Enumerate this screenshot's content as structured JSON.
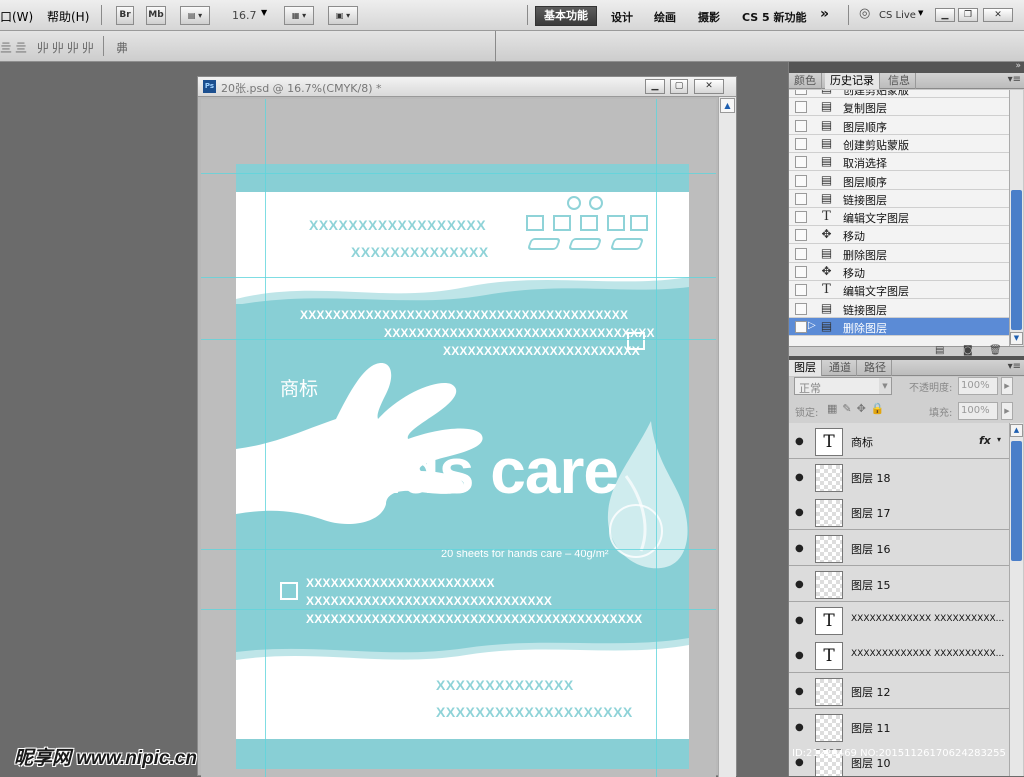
{
  "menu": {
    "window": "口(W)",
    "help": "帮助(H)"
  },
  "toolbar": {
    "bridge": "Br",
    "minibridge": "Mb",
    "zoom": "16.7"
  },
  "workspaces": [
    "基本功能",
    "设计",
    "绘画",
    "摄影",
    "CS 5 新功能"
  ],
  "cs_live": "CS Live",
  "document": {
    "title": "20张.psd @ 16.7%(CMYK/8) *",
    "header_xx_1": "XXXXXXXXXXXXXXXXXX",
    "header_xx_2": "XXXXXXXXXXXXXX",
    "band_xx_1": "XXXXXXXXXXXXXXXXXXXXXXXXXXXXXXXXXXXXXXXX",
    "band_xx_2": "XXXXXXXXXXXXXXXXXXXXXXXXXXXXXXXXX",
    "band_xx_3": "XXXXXXXXXXXXXXXXXXXXXXXX",
    "trademark": "商标",
    "brand": "hands care",
    "subtitle": "20 sheets for hands care – 40g/m²",
    "band_xx_4": "XXXXXXXXXXXXXXXXXXXXXXX",
    "band_xx_5": "XXXXXXXXXXXXXXXXXXXXXXXXXXXXXX",
    "band_xx_6": "XXXXXXXXXXXXXXXXXXXXXXXXXXXXXXXXXXXXXXXXX",
    "footer_xx_1": "XXXXXXXXXXXXXX",
    "footer_xx_2": "XXXXXXXXXXXXXXXXXXXX"
  },
  "history_panel": {
    "tabs": [
      "颜色",
      "历史记录",
      "信息"
    ],
    "items": [
      {
        "icon": "doc-icon",
        "label": "创建剪贴蒙版"
      },
      {
        "icon": "doc-icon",
        "label": "复制图层"
      },
      {
        "icon": "doc-icon",
        "label": "图层顺序"
      },
      {
        "icon": "doc-icon",
        "label": "创建剪贴蒙版"
      },
      {
        "icon": "doc-icon",
        "label": "取消选择"
      },
      {
        "icon": "doc-icon",
        "label": "图层顺序"
      },
      {
        "icon": "doc-icon",
        "label": "链接图层"
      },
      {
        "icon": "type-icon",
        "label": "编辑文字图层"
      },
      {
        "icon": "move-icon",
        "label": "移动"
      },
      {
        "icon": "doc-icon",
        "label": "删除图层"
      },
      {
        "icon": "move-icon",
        "label": "移动"
      },
      {
        "icon": "type-icon",
        "label": "编辑文字图层"
      },
      {
        "icon": "doc-icon",
        "label": "链接图层"
      },
      {
        "icon": "doc-icon",
        "label": "删除图层"
      }
    ]
  },
  "layers_panel": {
    "tabs": [
      "图层",
      "通道",
      "路径"
    ],
    "blend_mode": "正常",
    "opacity_label": "不透明度:",
    "opacity_value": "100%",
    "lock_label": "锁定:",
    "fill_label": "填充:",
    "fill_value": "100%",
    "fx": "fx",
    "layers": [
      {
        "type": "text",
        "name": "商标"
      },
      {
        "type": "image",
        "name": "图层 18"
      },
      {
        "type": "image",
        "name": "图层 17"
      },
      {
        "type": "image",
        "name": "图层 16"
      },
      {
        "type": "image",
        "name": "图层 15"
      },
      {
        "type": "text",
        "name": "XXXXXXXXXXXXX XXXXXXXXXX..."
      },
      {
        "type": "text",
        "name": "XXXXXXXXXXXXX XXXXXXXXXX..."
      },
      {
        "type": "image",
        "name": "图层 12"
      },
      {
        "type": "image",
        "name": "图层 11"
      },
      {
        "type": "image",
        "name": "图层 10"
      }
    ]
  },
  "watermark": {
    "site": "昵享网 www.nipic.cn",
    "id": "ID:21220469 NO:20151126170624283255"
  }
}
